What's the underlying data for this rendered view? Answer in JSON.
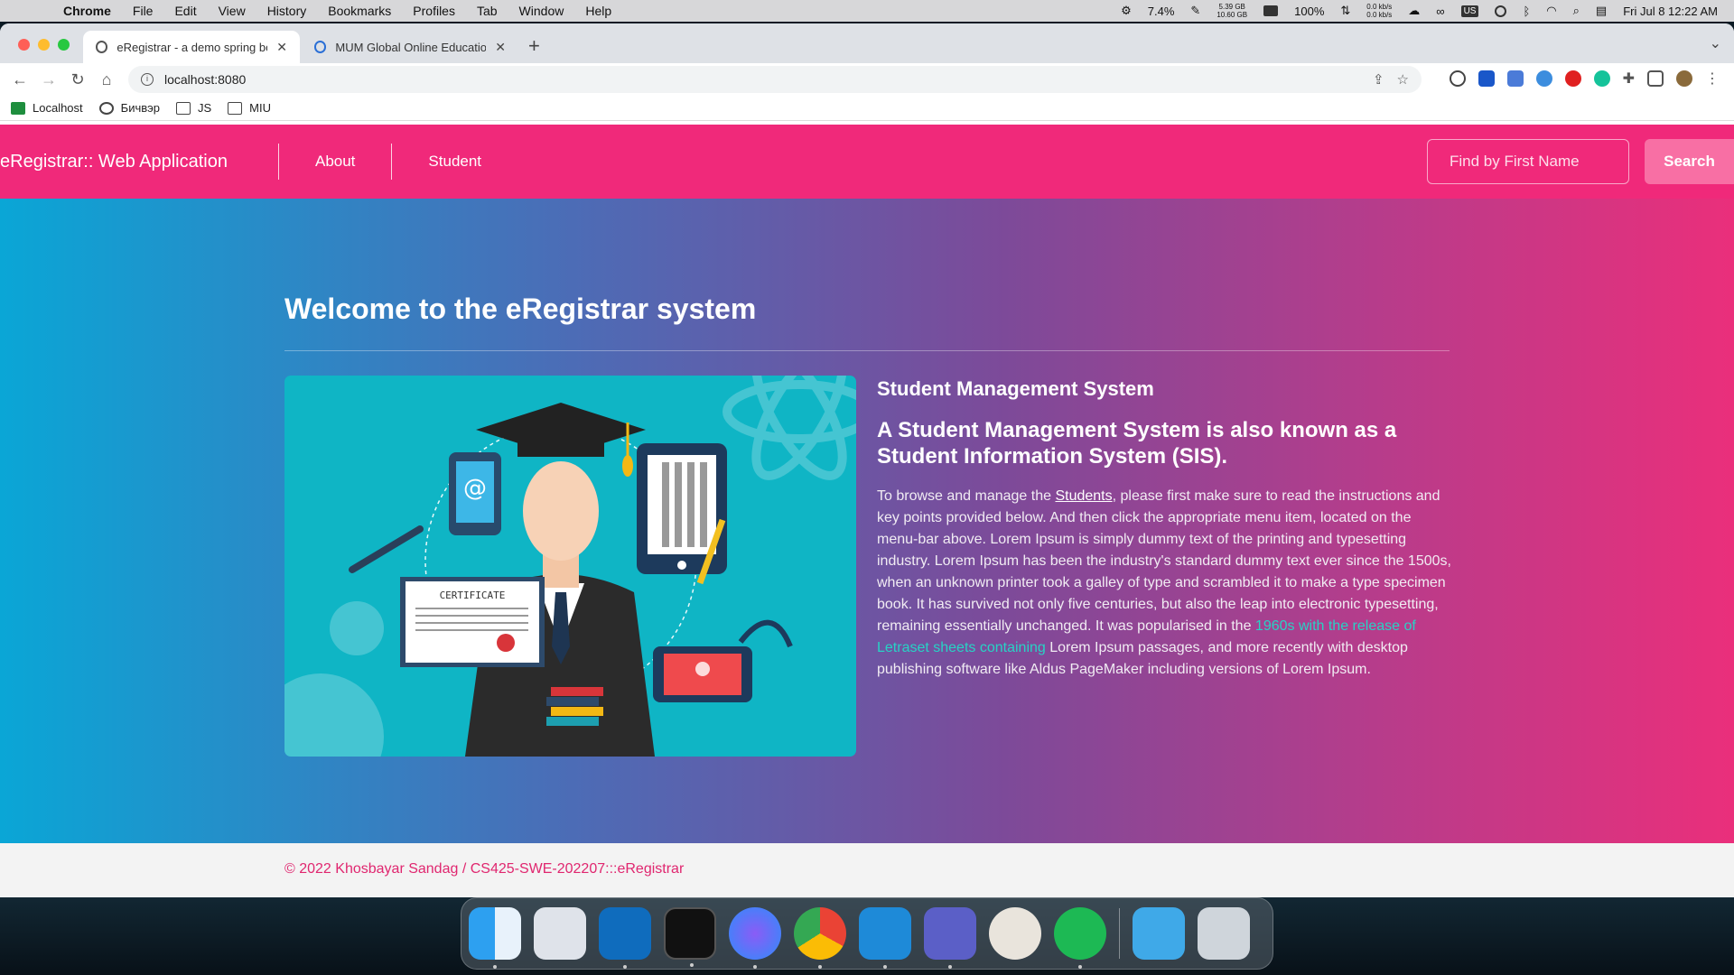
{
  "menubar": {
    "app": "Chrome",
    "items": [
      "File",
      "Edit",
      "View",
      "History",
      "Bookmarks",
      "Profiles",
      "Tab",
      "Window",
      "Help"
    ],
    "cpu": "7.4%",
    "mem_top": "5.39 GB",
    "mem_bottom": "10.60 GB",
    "battery": "100%",
    "net_top": "0.0 kb/s",
    "net_bottom": "0.0 kb/s",
    "keyboard": "US",
    "datetime": "Fri Jul 8  12:22 AM"
  },
  "tabs": [
    {
      "title": "eRegistrar - a demo spring boot"
    },
    {
      "title": "MUM Global Online Education"
    }
  ],
  "address": {
    "url": "localhost:8080"
  },
  "bookmarks": [
    "Localhost",
    "Бичвэр",
    "JS",
    "MIU"
  ],
  "navbar": {
    "brand": "eRegistrar:: Web Application",
    "links": [
      "About",
      "Student"
    ],
    "search_placeholder": "Find by First Name",
    "search_button": "Search"
  },
  "hero": {
    "title": "Welcome to the eRegistrar system",
    "subtitle": "Student Management System",
    "heading": "A Student Management System is also known as a Student Information System (SIS).",
    "para_before": "To browse and manage the ",
    "students_link": "Students",
    "para_middle": ", please first make sure to read the instructions and key points provided below. And then click the appropriate menu item, located on the menu-bar above. Lorem Ipsum is simply dummy text of the printing and typesetting industry. Lorem Ipsum has been the industry's standard dummy text ever since the 1500s, when an unknown printer took a galley of type and scrambled it to make a type specimen book. It has survived not only five centuries, but also the leap into electronic typesetting, remaining essentially unchanged. It was popularised in the ",
    "para_teal": "1960s with the release of Letraset sheets containing",
    "para_after": " Lorem Ipsum passages, and more recently with desktop publishing software like Aldus PageMaker including versions of Lorem Ipsum.",
    "certificate": "CERTIFICATE"
  },
  "footer": {
    "text": "© 2022 Khosbayar Sandag / CS425-SWE-202207:::eRegistrar"
  },
  "colors": {
    "navbar": "#f0297a",
    "footer_text": "#e0266f",
    "illustration_bg": "#0fb5c5"
  }
}
